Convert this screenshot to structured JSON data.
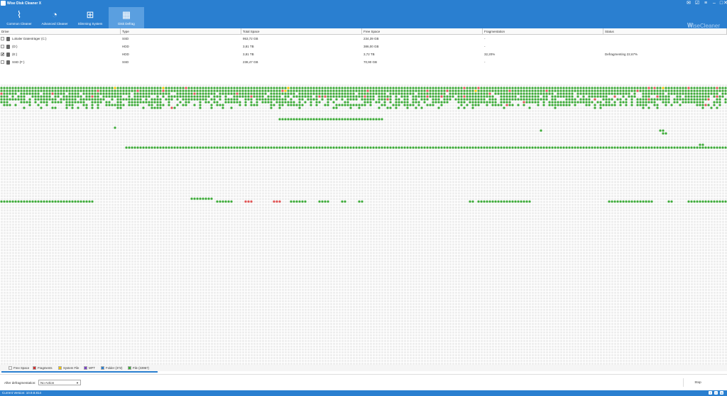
{
  "app": {
    "title": "Wise Disk Cleaner X",
    "brand": "WiseCleaner",
    "brand_letter": "W"
  },
  "window_controls": [
    "✉",
    "☑",
    "≡",
    "–",
    "□",
    "✕"
  ],
  "toolbar": {
    "tabs": [
      {
        "label": "Common Cleaner",
        "icon": "broom-icon",
        "glyph": "⌇"
      },
      {
        "label": "Advanced Cleaner",
        "icon": "wifi-icon",
        "glyph": "◔"
      },
      {
        "label": "Slimming System",
        "icon": "windows-icon",
        "glyph": "⊞"
      },
      {
        "label": "Disk Defrag",
        "icon": "defrag-icon",
        "glyph": "▦"
      }
    ],
    "active_tab": "Disk Defrag"
  },
  "drives_table": {
    "columns": [
      "Drive",
      "Type",
      "Total Space",
      "Free Space",
      "Fragmentation",
      "Status"
    ],
    "rows": [
      {
        "checked": false,
        "drive": "Lokaler Datenträger (C:)",
        "type": "SSD",
        "total": "953,72 GB",
        "free": "234,39 GB",
        "frag": "-",
        "status": ""
      },
      {
        "checked": false,
        "drive": "(D:)",
        "type": "HDD",
        "total": "3,81 TB",
        "free": "386,00 GB",
        "frag": "-",
        "status": ""
      },
      {
        "checked": true,
        "drive": "(E:)",
        "type": "HDD",
        "total": "3,81 TB",
        "free": "3,72 TB",
        "frag": "32,20%",
        "status": "Defragmenting 22,67%"
      },
      {
        "checked": false,
        "drive": "SSD (F:)",
        "type": "SSD",
        "total": "238,47 GB",
        "free": "70,90 GB",
        "frag": "-",
        "status": ""
      }
    ]
  },
  "legend": [
    {
      "label": "Free Space",
      "color": "#f4f4f4"
    },
    {
      "label": "Fragments",
      "color": "#d32f2f"
    },
    {
      "label": "System File",
      "color": "#f2c400"
    },
    {
      "label": "MFT",
      "color": "#7b3fc9"
    },
    {
      "label": "Folder (372)",
      "color": "#2a7fd0"
    },
    {
      "label": "File (33967)",
      "color": "#3aaa35"
    }
  ],
  "colors": {
    "accent": "#2a7fd0",
    "file": "#3aaa35",
    "fragment": "#e05050",
    "system": "#f2c400",
    "mft": "#7b3fc9"
  },
  "footer": {
    "after_label": "After defragmentation:",
    "action_value": "No Action",
    "stop_label": "Stop"
  },
  "status": {
    "version": "Current Version: 10.9.8.814"
  },
  "social": [
    "f",
    "t",
    "m"
  ]
}
